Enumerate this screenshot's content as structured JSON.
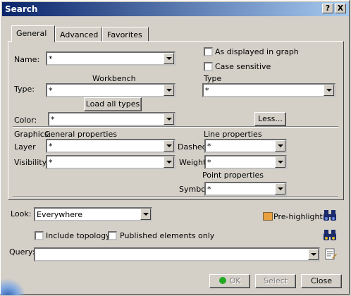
{
  "window": {
    "title": "Search",
    "help_label": "?",
    "close_label": "X"
  },
  "tabs": [
    {
      "label": "General"
    },
    {
      "label": "Advanced"
    },
    {
      "label": "Favorites"
    }
  ],
  "general": {
    "name_label": "Name:",
    "name_value": "*",
    "as_displayed_label": "As displayed in graph",
    "case_sensitive_label": "Case sensitive",
    "workbench_label": "Workbench",
    "type_label": "Type:",
    "workbench_value": "*",
    "type_col_label": "Type",
    "type_value": "*",
    "load_all_types_label": "Load all types",
    "color_label": "Color:",
    "color_value": "*",
    "less_label": "Less...",
    "graphics_label": "Graphics:",
    "general_properties_label": "General properties",
    "line_properties_label": "Line properties",
    "layer_label": "Layer",
    "layer_value": "*",
    "dashed_label": "Dashed",
    "dashed_value": "*",
    "visibility_label": "Visibility",
    "visibility_value": "*",
    "weight_label": "Weight",
    "weight_value": "*",
    "point_properties_label": "Point properties",
    "symbol_label": "Symbol",
    "symbol_value": "*"
  },
  "bottom": {
    "look_label": "Look:",
    "look_value": "Everywhere",
    "prehighlight_label": "Pre-highlight",
    "include_topology_label": "Include topology",
    "published_only_label": "Published elements only",
    "query_label": "Query:",
    "query_value": ""
  },
  "buttons": {
    "ok_label": "OK",
    "select_label": "Select",
    "close_label": "Close"
  },
  "colors": {
    "title_start": "#0a246a",
    "title_end": "#a6caf0",
    "face": "#d4d0c8",
    "ok_dot": "#22aa22"
  }
}
